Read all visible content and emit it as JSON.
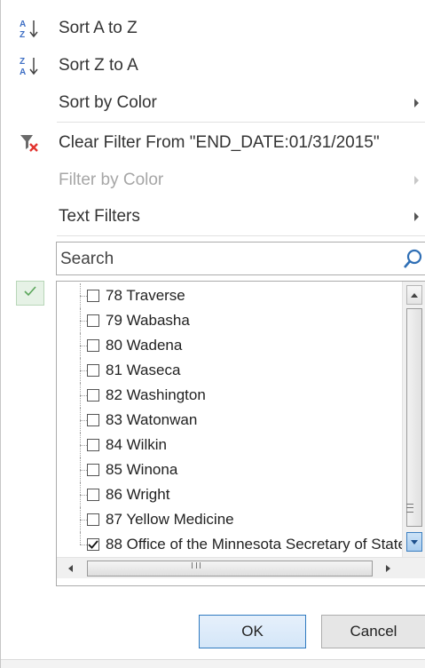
{
  "menu": {
    "sort_az": "Sort A to Z",
    "sort_za": "Sort Z to A",
    "sort_by_color": "Sort by Color",
    "clear_filter": "Clear Filter From \"END_DATE:01/31/2015\"",
    "filter_by_color": "Filter by Color",
    "text_filters": "Text Filters"
  },
  "search": {
    "placeholder": "Search"
  },
  "list": {
    "items": [
      {
        "label": "78 Traverse",
        "checked": false
      },
      {
        "label": "79 Wabasha",
        "checked": false
      },
      {
        "label": "80 Wadena",
        "checked": false
      },
      {
        "label": "81 Waseca",
        "checked": false
      },
      {
        "label": "82 Washington",
        "checked": false
      },
      {
        "label": "83 Watonwan",
        "checked": false
      },
      {
        "label": "84 Wilkin",
        "checked": false
      },
      {
        "label": "85 Winona",
        "checked": false
      },
      {
        "label": "86 Wright",
        "checked": false
      },
      {
        "label": "87 Yellow Medicine",
        "checked": false
      },
      {
        "label": "88 Office of the Minnesota Secretary of State",
        "checked": true
      }
    ]
  },
  "buttons": {
    "ok": "OK",
    "cancel": "Cancel"
  },
  "colors": {
    "accent": "#2f7ac0",
    "clear_filter_x": "#e2342f",
    "sort_blue": "#3d6ec4",
    "check_green": "#5aa65a"
  },
  "icons": {
    "sort_az": "sort-ascending-icon",
    "sort_za": "sort-descending-icon",
    "clear_filter": "clear-filter-icon",
    "search": "search-icon",
    "select_all": "checkmark-icon"
  }
}
